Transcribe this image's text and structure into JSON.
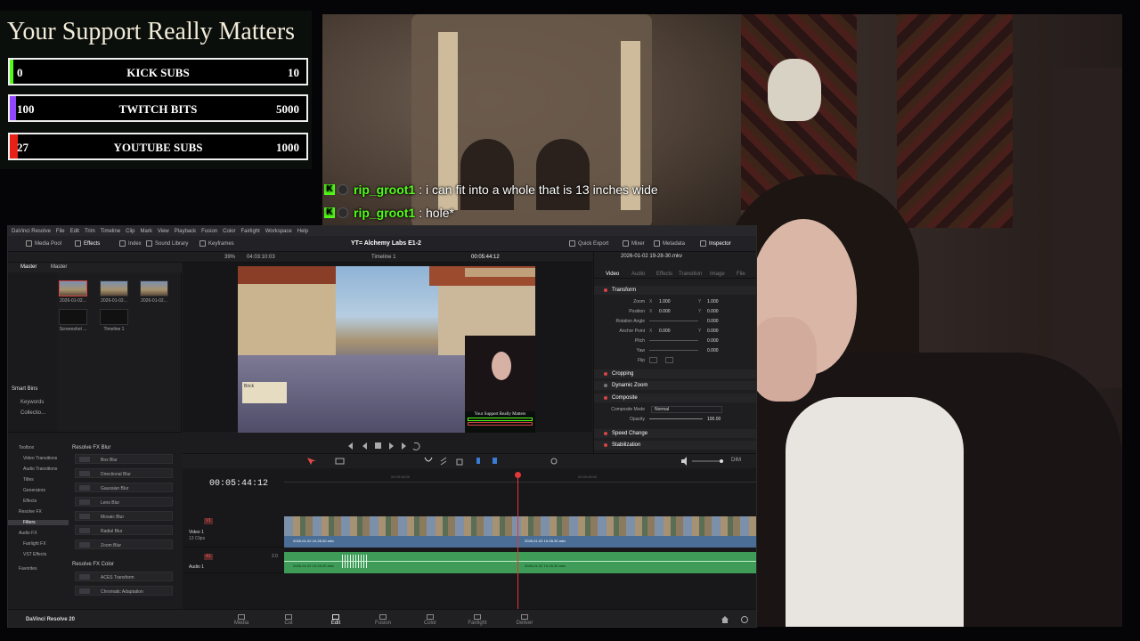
{
  "support": {
    "title": "Your Support Really Matters",
    "goals": [
      {
        "min": "0",
        "name": "KICK SUBS",
        "max": "10",
        "color": "#53fc18",
        "progress": 0
      },
      {
        "min": "100",
        "name": "TWITCH BITS",
        "max": "5000",
        "color": "#9146ff",
        "progress": 0.02
      },
      {
        "min": "27",
        "name": "YOUTUBE SUBS",
        "max": "1000",
        "color": "#e62117",
        "progress": 0.027
      }
    ]
  },
  "chat": [
    {
      "user": "rip_groot1",
      "message": ": i can fit into a whole that is 13 inches wide"
    },
    {
      "user": "rip_groot1",
      "message": ": hole*"
    }
  ],
  "resolve": {
    "menu": [
      "DaVinci Resolve",
      "File",
      "Edit",
      "Trim",
      "Timeline",
      "Clip",
      "Mark",
      "View",
      "Playback",
      "Fusion",
      "Color",
      "Fairlight",
      "Workspace",
      "Help"
    ],
    "toolbar": {
      "media_pool": "Media Pool",
      "effects": "Effects",
      "index": "Index",
      "sound_library": "Sound Library",
      "keyframes": "Keyframes",
      "project_title": "YT= Alchemy Labs E1-2",
      "quick_export": "Quick Export",
      "mixer": "Mixer",
      "metadata": "Metadata",
      "inspector": "Inspector"
    },
    "subbar": {
      "zoom": "39%",
      "source_tc": "04:03:10:03",
      "timeline_name": "Timeline 1",
      "record_tc": "00:05:44:12"
    },
    "media_pool": {
      "tabs": [
        "Master",
        "Master"
      ],
      "side": {
        "smart_bins": "Smart Bins",
        "keywords": "Keywords",
        "collections": "Collectio..."
      },
      "clips": [
        "2026-01-02...",
        "2026-01-02...",
        "2026-01-02...",
        "Screenshot ...",
        "Timeline 1"
      ]
    },
    "viewer": {
      "hud_name": "Brick",
      "overlay_title": "Your Support Really Matters"
    },
    "inspector": {
      "file": "2026-01-02 19-28-30.mkv",
      "tabs": [
        "Video",
        "Audio",
        "Effects",
        "Transition",
        "Image",
        "File"
      ],
      "transform": "Transform",
      "rows": [
        {
          "label": "Zoom",
          "x": "1.000",
          "y": "1.000"
        },
        {
          "label": "Position",
          "x": "0.000",
          "y": "0.000"
        },
        {
          "label": "Rotation Angle",
          "x": "",
          "y": "0.000"
        },
        {
          "label": "Anchor Point",
          "x": "0.000",
          "y": "0.000"
        },
        {
          "label": "Pitch",
          "x": "",
          "y": "0.000"
        },
        {
          "label": "Yaw",
          "x": "",
          "y": "0.000"
        },
        {
          "label": "Flip",
          "x": "",
          "y": ""
        }
      ],
      "cropping": "Cropping",
      "dynamic_zoom": "Dynamic Zoom",
      "composite": "Composite",
      "composite_mode_label": "Composite Mode",
      "composite_mode": "Normal",
      "opacity_label": "Opacity",
      "opacity": "100.00",
      "speed_change": "Speed Change",
      "stabilization": "Stabilization"
    },
    "toolbox": {
      "tree": [
        "Toolbox",
        "Video Transitions",
        "Audio Transitions",
        "Titles",
        "Generators",
        "Effects",
        "Resolve FX",
        "Filters",
        "Audio FX",
        "Fairlight FX",
        "VST Effects",
        "Favorites"
      ],
      "blur_header": "Resolve FX Blur",
      "blur": [
        "Box Blur",
        "Directional Blur",
        "Gaussian Blur",
        "Lens Blur",
        "Mosaic Blur",
        "Radial Blur",
        "Zoom Blur"
      ],
      "color_header": "Resolve FX Color",
      "color": [
        "ACES Transform",
        "Chromatic Adaptation"
      ]
    },
    "timeline": {
      "timecode": "00:05:44:12",
      "ruler": [
        "00:05:38:00",
        "00:05:48:00"
      ],
      "video_track": {
        "tag": "V1",
        "name": "Video 1",
        "count": "13 Clips"
      },
      "audio_track": {
        "tag": "A1",
        "name": "Audio 1",
        "level": "2.0"
      },
      "clip_label": "2026-01-02 19-28-30.mkv",
      "dim": "DIM"
    },
    "pages": {
      "brand": "DaVinci Resolve 20",
      "items": [
        "Media",
        "Cut",
        "Edit",
        "Fusion",
        "Color",
        "Fairlight",
        "Deliver"
      ],
      "active": "Edit"
    }
  }
}
